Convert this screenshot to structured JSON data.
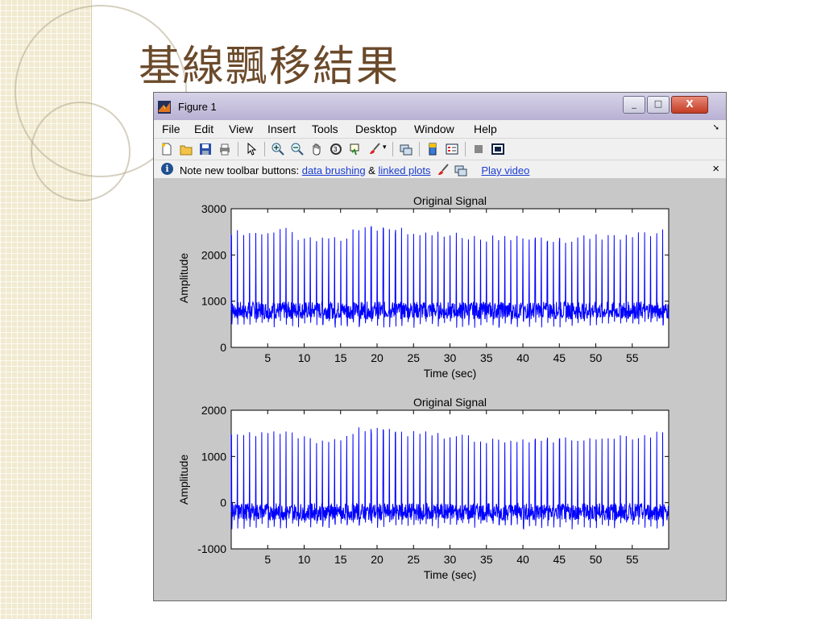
{
  "slide": {
    "title": "基線飄移結果"
  },
  "window": {
    "title": "Figure 1",
    "controls": {
      "minimize": "_",
      "maximize": "□",
      "close": "X"
    }
  },
  "menu": [
    "File",
    "Edit",
    "View",
    "Insert",
    "Tools",
    "Desktop",
    "Window",
    "Help"
  ],
  "toolbar_icons": [
    "new-figure-icon",
    "open-file-icon",
    "save-icon",
    "print-icon",
    "pointer-icon",
    "zoom-in-icon",
    "zoom-out-icon",
    "pan-icon",
    "rotate-3d-icon",
    "data-cursor-icon",
    "brush-icon",
    "link-plot-icon",
    "colorbar-icon",
    "legend-icon",
    "hide-plot-tools-icon",
    "show-plot-tools-icon"
  ],
  "infobar": {
    "prefix": "Note new toolbar buttons: ",
    "link1": "data brushing",
    "amp": " & ",
    "link2": "linked plots",
    "link3": "Play video",
    "close": "×"
  },
  "colors": {
    "signal": "#0000ff",
    "axes_bg": "#ffffff",
    "figure_bg": "#c8c8c8"
  },
  "chart_data": [
    {
      "type": "line",
      "title": "Original Signal",
      "xlabel": "Time (sec)",
      "ylabel": "Amplitude",
      "xlim": [
        0,
        60
      ],
      "ylim": [
        0,
        3000
      ],
      "xticks": [
        5,
        10,
        15,
        20,
        25,
        30,
        35,
        40,
        45,
        50,
        55
      ],
      "yticks": [
        0,
        1000,
        2000,
        3000
      ],
      "series": [
        {
          "baseline_approx": 800,
          "peak_approx": 2450,
          "beats_approx": 72,
          "color": "#0000ff"
        }
      ]
    },
    {
      "type": "line",
      "title": "Original Signal",
      "xlabel": "Time (sec)",
      "ylabel": "Amplitude",
      "xlim": [
        0,
        60
      ],
      "ylim": [
        -1000,
        2000
      ],
      "xticks": [
        5,
        10,
        15,
        20,
        25,
        30,
        35,
        40,
        45,
        50,
        55
      ],
      "yticks": [
        -1000,
        0,
        1000,
        2000
      ],
      "series": [
        {
          "baseline_approx": -200,
          "peak_approx": 1450,
          "beats_approx": 72,
          "color": "#0000ff"
        }
      ]
    }
  ]
}
